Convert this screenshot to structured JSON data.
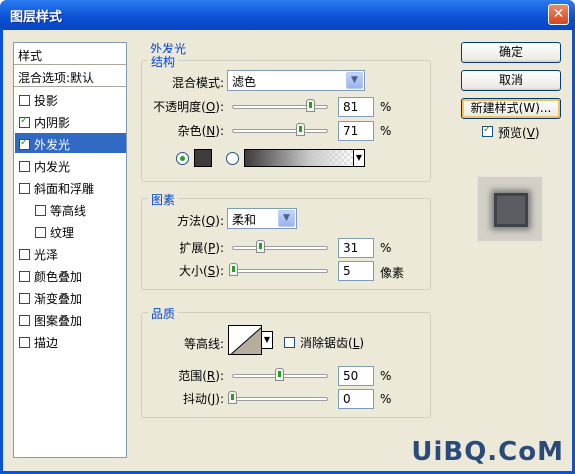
{
  "window": {
    "title": "图层样式",
    "close": "✕"
  },
  "sidebar": {
    "header": "样式",
    "subheader": "混合选项:默认",
    "items": [
      {
        "label": "投影",
        "checked": false,
        "selected": false,
        "indent": false
      },
      {
        "label": "内阴影",
        "checked": true,
        "selected": false,
        "indent": false
      },
      {
        "label": "外发光",
        "checked": true,
        "selected": true,
        "indent": false
      },
      {
        "label": "内发光",
        "checked": false,
        "selected": false,
        "indent": false
      },
      {
        "label": "斜面和浮雕",
        "checked": false,
        "selected": false,
        "indent": false
      },
      {
        "label": "等高线",
        "checked": false,
        "selected": false,
        "indent": true
      },
      {
        "label": "纹理",
        "checked": false,
        "selected": false,
        "indent": true
      },
      {
        "label": "光泽",
        "checked": false,
        "selected": false,
        "indent": false
      },
      {
        "label": "颜色叠加",
        "checked": false,
        "selected": false,
        "indent": false
      },
      {
        "label": "渐变叠加",
        "checked": false,
        "selected": false,
        "indent": false
      },
      {
        "label": "图案叠加",
        "checked": false,
        "selected": false,
        "indent": false
      },
      {
        "label": "描边",
        "checked": false,
        "selected": false,
        "indent": false
      }
    ]
  },
  "panel": {
    "title": "外发光",
    "structure": {
      "legend": "结构",
      "blend_mode_label": "混合模式:",
      "blend_mode_value": "滤色",
      "opacity_label": "不透明度(",
      "opacity_key": "O",
      "opacity_value": "81",
      "noise_label": "杂色(",
      "noise_key": "N",
      "noise_value": "71",
      "unit_pct": "%",
      "color_hex": "#3f3b3b"
    },
    "elements": {
      "legend": "图素",
      "method_label": "方法(",
      "method_key": "Q",
      "method_value": "柔和",
      "spread_label": "扩展(",
      "spread_key": "P",
      "spread_value": "31",
      "size_label": "大小(",
      "size_key": "S",
      "size_value": "5",
      "size_unit": "像素"
    },
    "quality": {
      "legend": "品质",
      "contour_label": "等高线:",
      "antialias_label": "消除锯齿(",
      "antialias_key": "L",
      "range_label": "范围(",
      "range_key": "R",
      "range_value": "50",
      "jitter_label": "抖动(",
      "jitter_key": "J",
      "jitter_value": "0"
    }
  },
  "buttons": {
    "ok": "确定",
    "cancel": "取消",
    "new_style": "新建样式(W)...",
    "preview_label": "预览(",
    "preview_key": "V",
    "preview_checked": true
  },
  "watermark": "UiBQ.CoM"
}
